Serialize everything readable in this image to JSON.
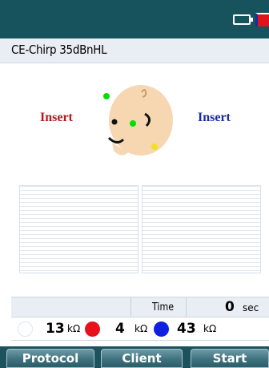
{
  "status_bar": {
    "battery_icon": "battery-icon",
    "flag_icon": "flag-icon"
  },
  "header": {
    "title": "CE-Chirp 35dBnHL"
  },
  "ears": {
    "left_label": "Insert",
    "right_label": "Insert",
    "left_color": "#b5171c",
    "right_color": "#1c2aa3"
  },
  "electrodes": {
    "colors": [
      "#00e000",
      "#00e000",
      "#f0e020"
    ]
  },
  "status": {
    "time_label": "Time",
    "time_value": "0",
    "time_unit": "sec"
  },
  "impedance": {
    "items": [
      {
        "color": "white",
        "value": "13",
        "unit": "kΩ"
      },
      {
        "color": "red",
        "value": "4",
        "unit": "kΩ"
      },
      {
        "color": "blue",
        "value": "43",
        "unit": "kΩ"
      }
    ]
  },
  "buttons": {
    "protocol": "Protocol",
    "client": "Client",
    "start": "Start"
  }
}
